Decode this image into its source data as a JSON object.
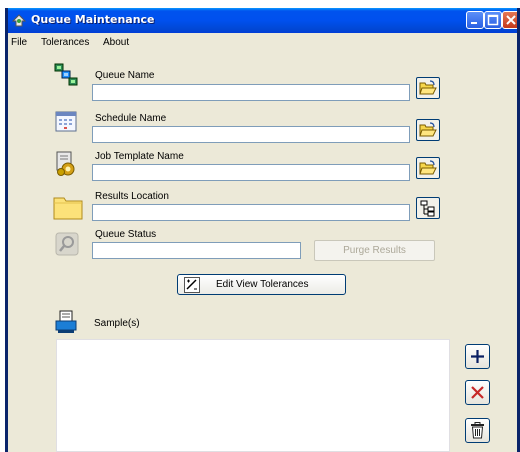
{
  "window": {
    "title": "Queue Maintenance"
  },
  "menu": {
    "items": [
      "File",
      "Tolerances",
      "About"
    ]
  },
  "fields": {
    "queue_name": {
      "label": "Queue Name",
      "value": ""
    },
    "schedule_name": {
      "label": "Schedule Name",
      "value": ""
    },
    "job_template_name": {
      "label": "Job Template Name",
      "value": ""
    },
    "results_location": {
      "label": "Results Location",
      "value": ""
    },
    "queue_status": {
      "label": "Queue Status",
      "value": ""
    }
  },
  "buttons": {
    "purge_results": "Purge Results",
    "edit_view_tolerances": "Edit View Tolerances"
  },
  "samples": {
    "label": "Sample(s)",
    "items": []
  },
  "icons": {
    "queue": "queue-icon",
    "schedule": "calendar-icon",
    "job_template": "job-template-icon",
    "results_location": "folder-icon",
    "queue_status": "status-icon",
    "browse": "open-folder-icon",
    "tree": "tree-icon",
    "tolerances": "tolerance-icon",
    "sample": "sample-icon",
    "add": "plus-icon",
    "remove": "close-icon",
    "delete": "trash-icon"
  },
  "colors": {
    "titlebar": "#0053EE",
    "window_bg": "#ECE9D8",
    "field_border": "#7F9DB9"
  }
}
